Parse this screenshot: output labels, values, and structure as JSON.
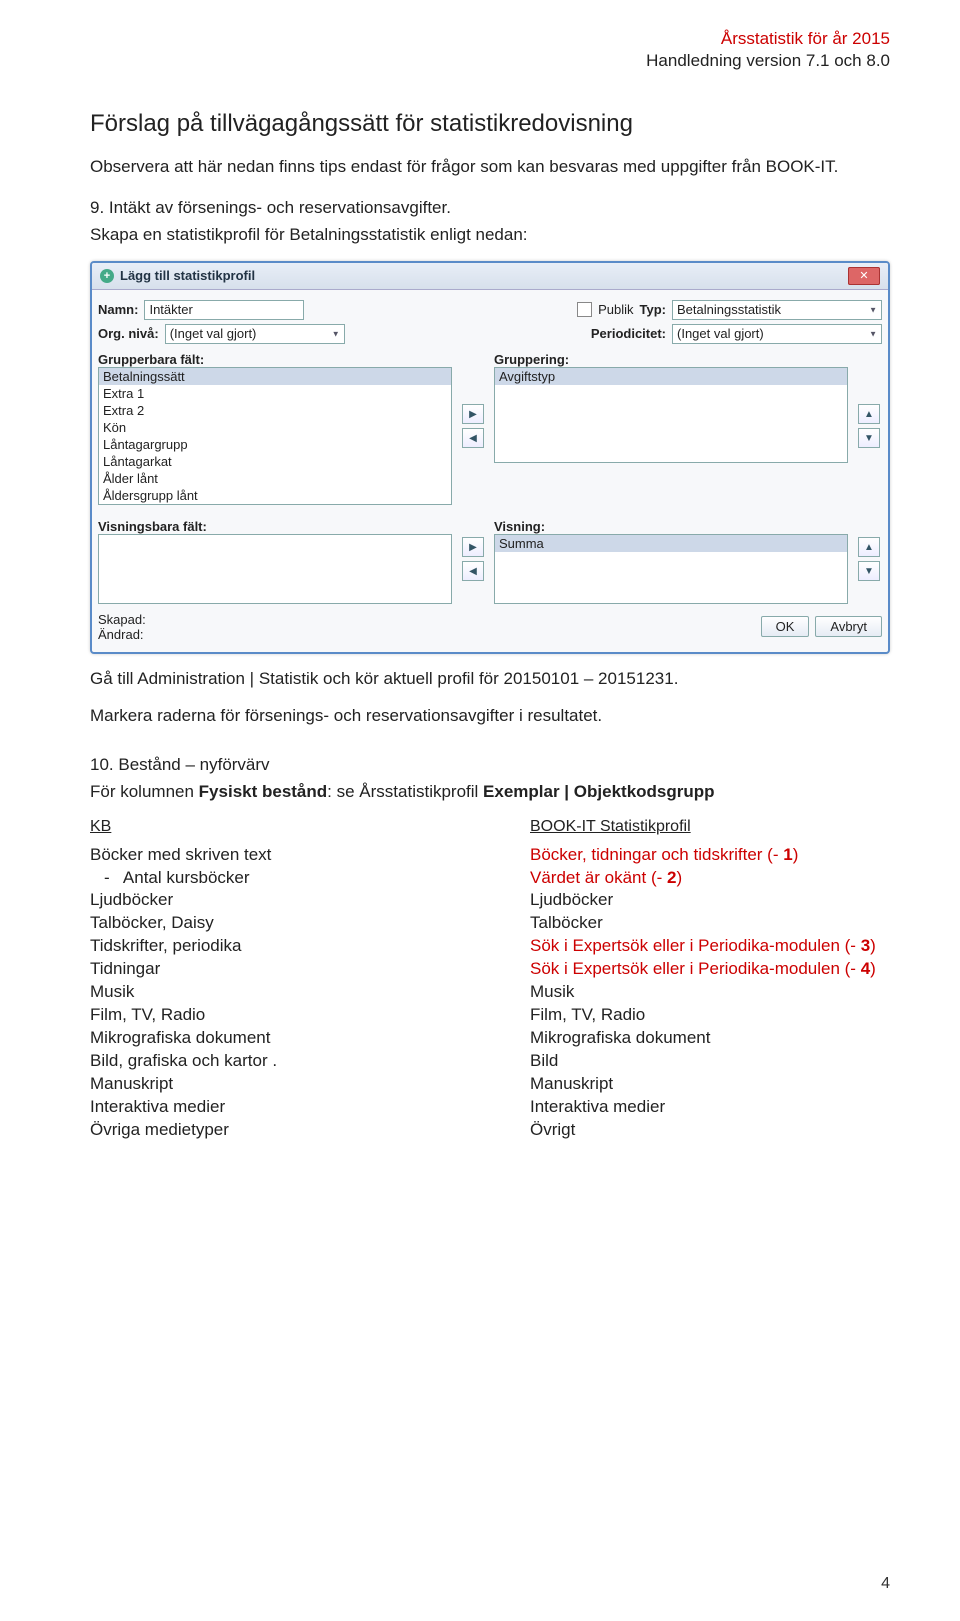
{
  "header": {
    "line1": "Årsstatistik för år 2015",
    "line2": "Handledning version 7.1 och 8.0"
  },
  "title": "Förslag på tillvägagångssätt för statistikredovisning",
  "intro1": "Observera att här nedan finns tips endast för frågor som kan besvaras med uppgifter från BOOK-IT.",
  "sect9_title": "9. Intäkt av försenings- och reservationsavgifter.",
  "sect9_sub": "Skapa en statistikprofil för Betalningsstatistik enligt nedan:",
  "dialog": {
    "title": "Lägg till statistikprofil",
    "namn_lbl": "Namn:",
    "namn_val": "Intäkter",
    "publik_lbl": "Publik",
    "typ_lbl": "Typ:",
    "typ_val": "Betalningsstatistik",
    "orgniva_lbl": "Org. nivå:",
    "orgniva_val": "(Inget val gjort)",
    "period_lbl": "Periodicitet:",
    "period_val": "(Inget val gjort)",
    "grupperbara_lbl": "Grupperbara fält:",
    "gruppering_lbl": "Gruppering:",
    "grupperbara_items": [
      "Betalningssätt",
      "Extra 1",
      "Extra 2",
      "Kön",
      "Låntagargrupp",
      "Låntagarkat",
      "Ålder lånt",
      "Åldersgrupp lånt"
    ],
    "gruppering_items": [
      "Avgiftstyp"
    ],
    "visningsbara_lbl": "Visningsbara fält:",
    "visning_lbl": "Visning:",
    "visning_items": [
      "Summa"
    ],
    "skapad_lbl": "Skapad:",
    "andrad_lbl": "Ändrad:",
    "ok": "OK",
    "avbryt": "Avbryt"
  },
  "after": {
    "p1": "Gå till Administration | Statistik och kör aktuell profil för 20150101 – 20151231.",
    "p2": "Markera raderna för försenings- och reservationsavgifter i resultatet."
  },
  "sect10": {
    "title": "10. Bestånd – nyförvärv",
    "sub_a": "För kolumnen ",
    "sub_b": "Fysiskt bestånd",
    "sub_c": ": se Årsstatistikprofil ",
    "sub_d": "Exemplar | Objektkodsgrupp"
  },
  "cols": {
    "left_head": "KB",
    "right_head": "BOOK-IT Statistikprofil",
    "left": [
      "Böcker med skriven text",
      "Antal kursböcker",
      "Ljudböcker",
      "Talböcker, Daisy",
      "Tidskrifter, periodika",
      "Tidningar",
      "Musik",
      "Film, TV, Radio",
      "Mikrografiska dokument",
      "Bild, grafiska och kartor .",
      "Manuskript",
      "Interaktiva medier",
      "Övriga medietyper"
    ],
    "right": [
      {
        "t": "Böcker, tidningar och tidskrifter (- 1)",
        "red": true,
        "bold": "1"
      },
      {
        "t": "Värdet är okänt (- 2)",
        "red": true,
        "bold": "2"
      },
      {
        "t": "Ljudböcker"
      },
      {
        "t": "Talböcker"
      },
      {
        "t": "Sök i Expertsök eller i Periodika-modulen (- 3)",
        "red": true,
        "bold": "3"
      },
      {
        "t": "Sök i Expertsök eller i Periodika-modulen (- 4)",
        "red": true,
        "bold": "4"
      },
      {
        "t": "Musik"
      },
      {
        "t": "Film, TV, Radio"
      },
      {
        "t": "Mikrografiska dokument"
      },
      {
        "t": "Bild"
      },
      {
        "t": "Manuskript"
      },
      {
        "t": "Interaktiva medier"
      },
      {
        "t": "Övrigt"
      }
    ]
  },
  "pageNum": "4"
}
